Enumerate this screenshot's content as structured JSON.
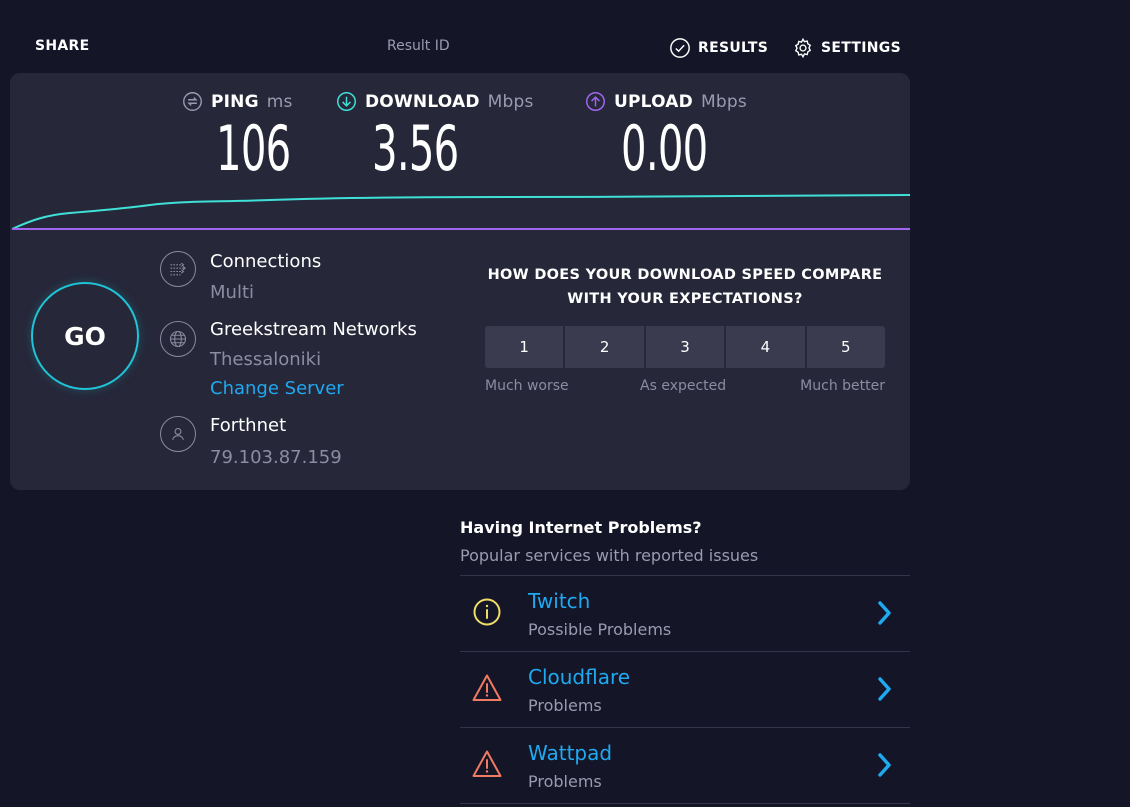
{
  "topbar": {
    "share_label": "SHARE",
    "result_id_label": "Result ID",
    "results_label": "RESULTS",
    "settings_label": "SETTINGS"
  },
  "metrics": {
    "ping": {
      "label": "PING",
      "unit": "ms",
      "value": "106",
      "icon": "ping-icon"
    },
    "download": {
      "label": "DOWNLOAD",
      "unit": "Mbps",
      "value": "3.56",
      "icon": "download-arrow-icon"
    },
    "upload": {
      "label": "UPLOAD",
      "unit": "Mbps",
      "value": "0.00",
      "icon": "upload-arrow-icon"
    }
  },
  "go_label": "GO",
  "connections": {
    "title": "Connections",
    "value": "Multi",
    "icon": "connections-icon"
  },
  "server": {
    "title": "Greekstream Networks",
    "location": "Thessaloniki",
    "change_label": "Change Server",
    "icon": "globe-icon"
  },
  "provider": {
    "title": "Forthnet",
    "ip": "79.103.87.159",
    "icon": "user-icon"
  },
  "survey": {
    "question_line1": "HOW DOES YOUR DOWNLOAD SPEED COMPARE",
    "question_line2": "WITH YOUR EXPECTATIONS?",
    "options": [
      "1",
      "2",
      "3",
      "4",
      "5"
    ],
    "label_low": "Much worse",
    "label_mid": "As expected",
    "label_high": "Much better"
  },
  "problems": {
    "title": "Having Internet Problems?",
    "subtitle": "Popular services with reported issues",
    "items": [
      {
        "name": "Twitch",
        "status": "Possible Problems",
        "icon": "info-circle-icon"
      },
      {
        "name": "Cloudflare",
        "status": "Problems",
        "icon": "warning-triangle-icon"
      },
      {
        "name": "Wattpad",
        "status": "Problems",
        "icon": "warning-triangle-icon"
      }
    ]
  },
  "colors": {
    "background": "#141526",
    "panel": "#262738",
    "download_accent": "#3fe0d8",
    "upload_accent": "#a066f0",
    "link": "#1fa9f0",
    "go_ring": "#1fc4d6",
    "info_yellow": "#f0dc6a",
    "warning_red": "#f07a62"
  }
}
